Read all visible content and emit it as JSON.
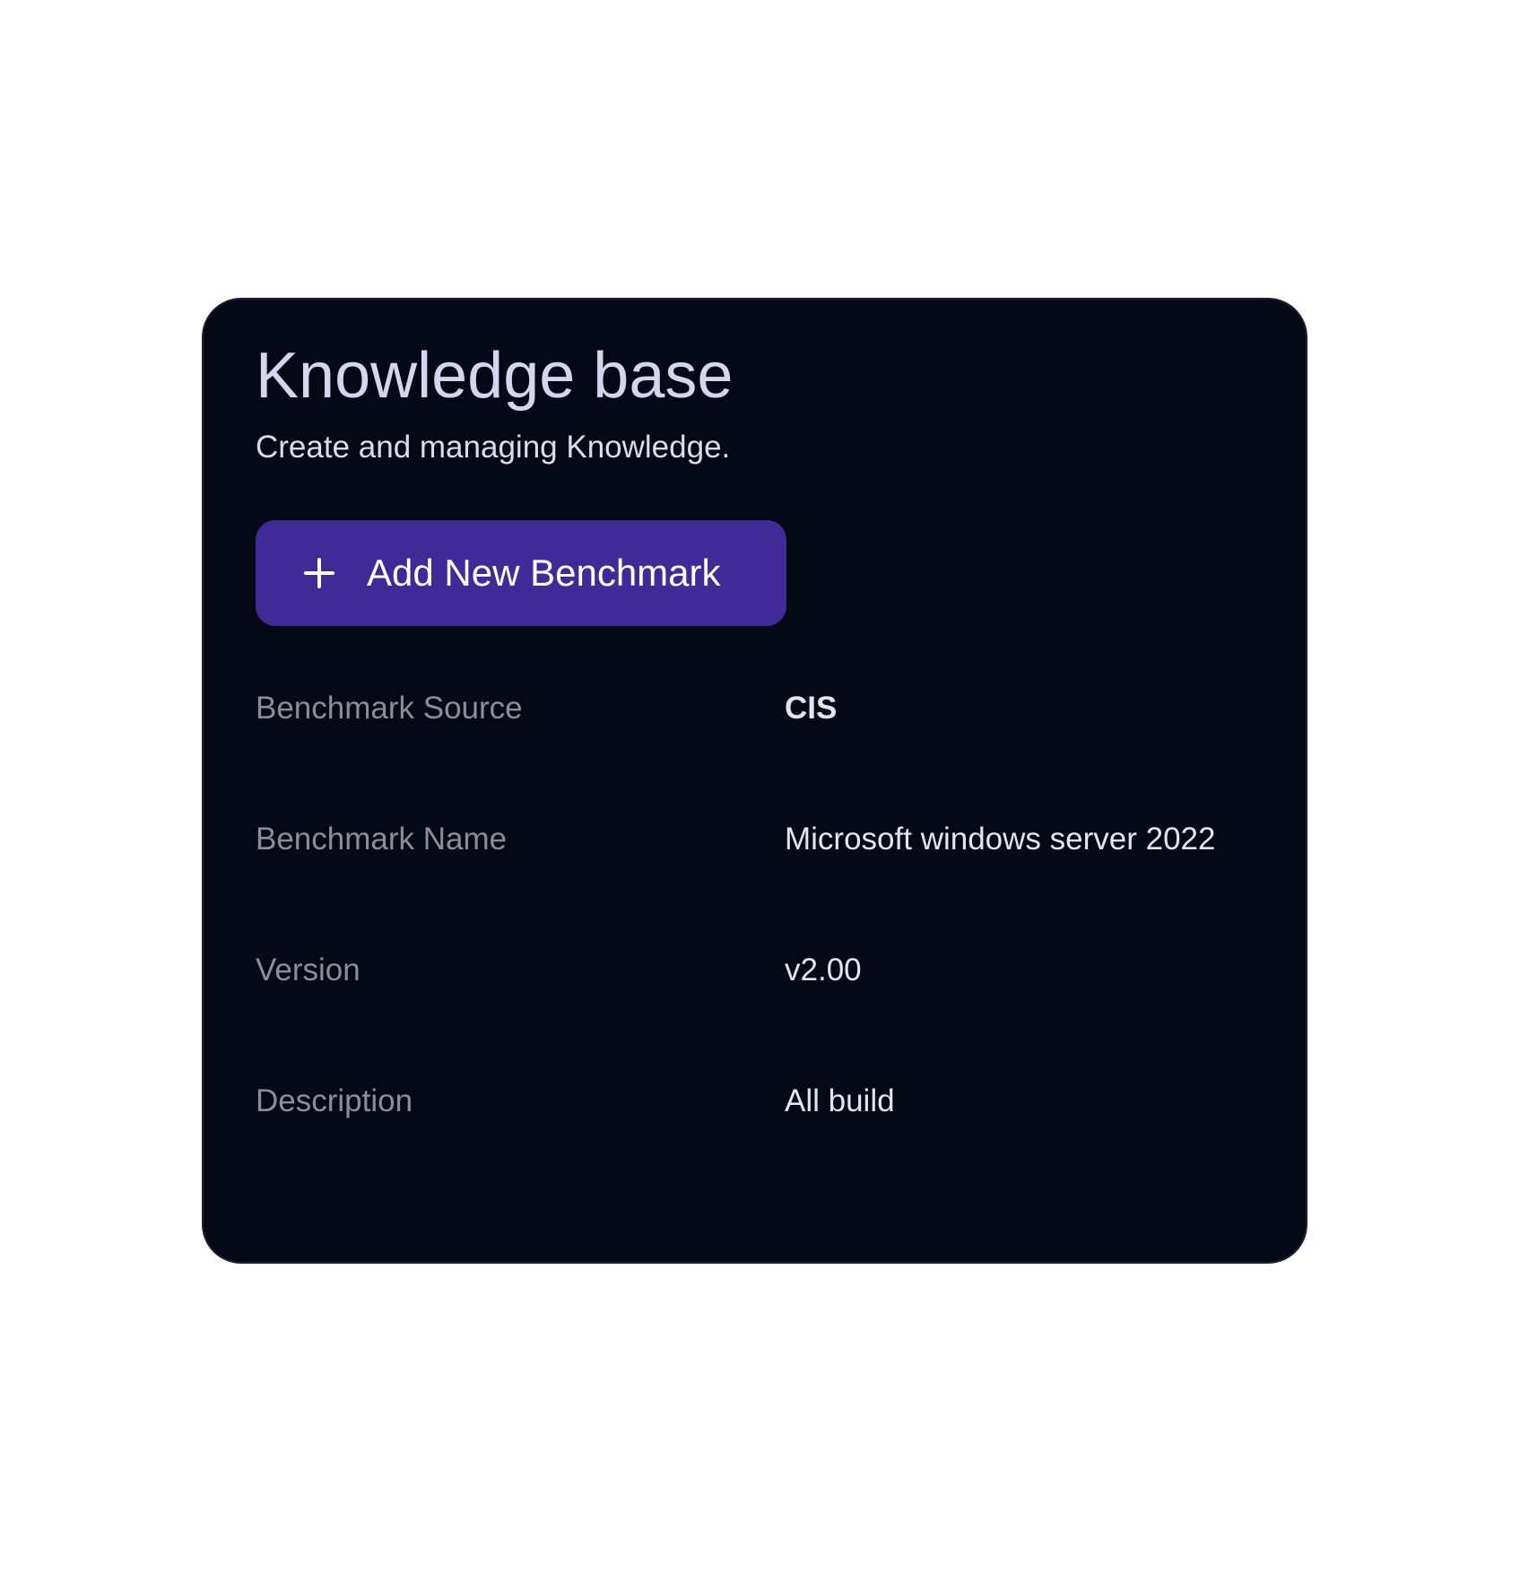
{
  "header": {
    "title": "Knowledge base",
    "subtitle": "Create and managing Knowledge."
  },
  "actions": {
    "add_button_label": "Add New Benchmark",
    "add_button_icon": "plus-icon",
    "add_button_color": "#3f2a98"
  },
  "details": {
    "rows": [
      {
        "label": "Benchmark Source",
        "value": "CIS"
      },
      {
        "label": "Benchmark Name",
        "value": "Microsoft windows server 2022"
      },
      {
        "label": "Version",
        "value": "v2.00"
      },
      {
        "label": "Description",
        "value": "All build"
      }
    ]
  },
  "theme": {
    "card_background": "#040915",
    "page_background": "#fefefe"
  }
}
